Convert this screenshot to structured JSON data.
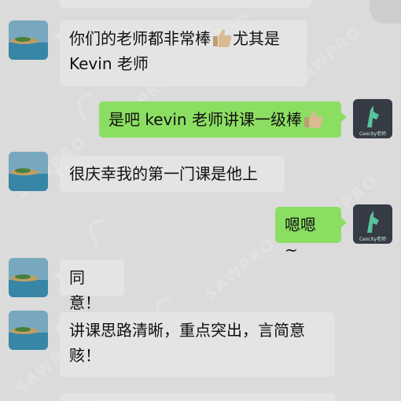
{
  "chat": {
    "messages": [
      {
        "side": "left",
        "text": "你们的老师都非常棒",
        "emoji": "thumbs-up",
        "text2": "尤其是",
        "line2": "Kevin 老师"
      },
      {
        "side": "right",
        "text": "是吧 kevin 老师讲课一级棒",
        "emoji": "thumbs-up"
      },
      {
        "side": "left",
        "text": "很庆幸我的第一门课是他上"
      },
      {
        "side": "right",
        "text": "嗯嗯 ~"
      },
      {
        "side": "left",
        "text": "同意！"
      },
      {
        "side": "left",
        "line1": "讲课思路清晰，重点突出，言简意",
        "line2": "赅！"
      }
    ]
  },
  "avatars": {
    "teacher_label": "Cexcity老师"
  },
  "watermark": {
    "text": "SAWPRO"
  },
  "colors": {
    "background": "#e9e9e9",
    "incoming_bubble": "#f3f3f3",
    "outgoing_bubble": "#95ec69"
  }
}
